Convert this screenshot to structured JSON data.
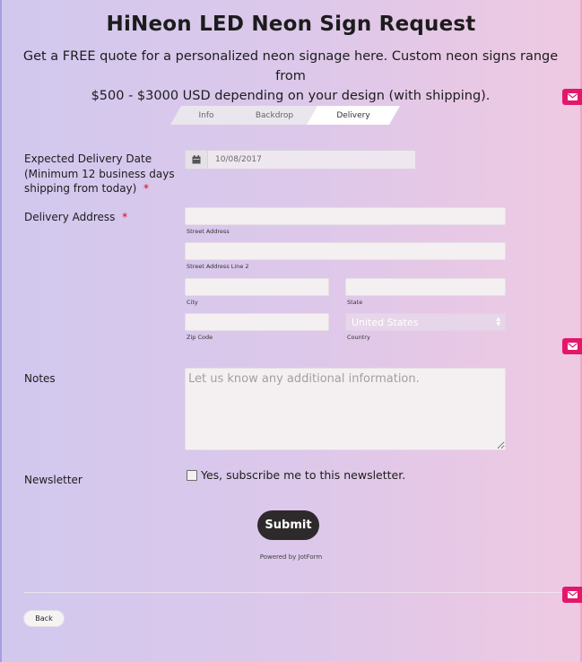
{
  "header": {
    "title": "HiNeon LED Neon Sign Request",
    "subtitle_line1": "Get a FREE quote for a personalized neon signage here. Custom neon signs range from",
    "subtitle_line2": "$500 - $3000 USD depending on your design (with shipping)."
  },
  "tabs": [
    {
      "label": "Info",
      "active": false
    },
    {
      "label": "Backdrop",
      "active": false
    },
    {
      "label": "Delivery",
      "active": true
    }
  ],
  "delivery_date": {
    "label_line1": "Expected Delivery Date",
    "label_line2": "(Minimum 12 business days",
    "label_line3": "shipping from today)",
    "required_mark": "*",
    "value": "10/08/2017",
    "icon": "calendar-icon"
  },
  "address": {
    "label": "Delivery Address",
    "required_mark": "*",
    "street": {
      "value": "",
      "sublabel": "Street Address"
    },
    "street2": {
      "value": "",
      "sublabel": "Street Address Line 2"
    },
    "city": {
      "value": "",
      "sublabel": "City"
    },
    "state": {
      "value": "",
      "sublabel": "State"
    },
    "zip": {
      "value": "",
      "sublabel": "Zip Code"
    },
    "country": {
      "value": "United States",
      "sublabel": "Country"
    }
  },
  "notes": {
    "label": "Notes",
    "placeholder": "Let us know any additional information."
  },
  "newsletter": {
    "label": "Newsletter",
    "checkbox_label": "Yes, subscribe me to this newsletter.",
    "checked": false
  },
  "submit_label": "Submit",
  "powered_by": "Powered by JotForm",
  "back_label": "Back",
  "side_tabs": {
    "icon": "mail-icon",
    "color": "#e3176c"
  },
  "colors": {
    "gradient_left": "#d1c8ee",
    "gradient_right": "#efc9e2",
    "submit_bg": "#2e2a2c"
  }
}
